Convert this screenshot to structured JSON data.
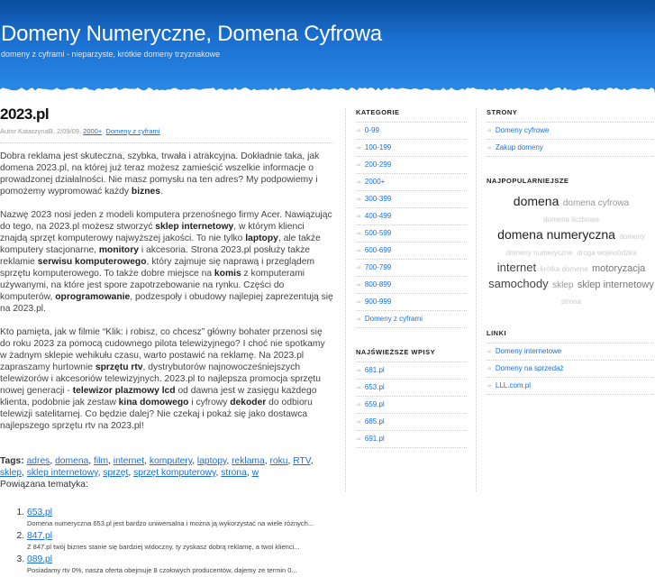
{
  "header": {
    "title": "Domeny Numeryczne, Domena Cyfrowa",
    "description": "domeny z cyframi - nieparzyste, krótkie domeny trzyznakowe"
  },
  "post": {
    "title": "2023.pl",
    "meta_prefix": "Autor KatarzynaB. 2/09/09.",
    "categories": [
      "2000+",
      "Domeny z cyframi"
    ],
    "p1": [
      "Dobra reklama jest skuteczna, szybka, trwała i atrakcyjna. Dokładnie taka, jak domena 2023.pl, na której już teraz możesz zamieścić wszelkie informacje o prowadzonej działalności. Nie masz pomysłu na ten adres? My podpowiemy i pomożemy wypromować każdy ",
      "biznes",
      "."
    ],
    "p2": [
      "Nazwę 2023 nosi jeden z modeli komputera przenośnego firmy Acer. Nawiązując do tego, na 2023.pl możesz stworzyć ",
      "sklep internetowy",
      ", w którym klienci znajdą sprzęt komputerowy najwyższej jakości. To nie tylko ",
      "laptopy",
      ", ale także komputery stacjonarne, ",
      "monitory",
      " i akcesoria. Strona 2023.pl posłuży także reklamie ",
      "serwisu komputerowego",
      ", który zajmuje się naprawą i przeglądem sprzętu komputerowego. To także dobre miejsce na ",
      "komis",
      " z komputerami używanymi, na które jest spore zapotrzebowanie na rynku. Części do komputerów, ",
      "oprogramowanie",
      ", podzespoły i obudowy najlepiej zaprezentują się na 2023.pl."
    ],
    "p3": [
      "Kto pamięta, jak w filmie “Klik: i robisz, co chcesz” główny bohater przenosi się do roku 2023 za pomocą cudownego pilota telewizyjnego? I choć nie spotkamy w żadnym sklepie wehikułu czasu, warto postawić na reklamę. Na 2023.pl zapraszamy hurtownie ",
      "sprzętu rtv",
      ", dystrybutorów najnowocześniejszych telewizorów i akcesoriów telewizyjnych. 2023.pl to najlepsza promocja sprzętu nowej generacji - ",
      "telewizor plazmowy lcd",
      " od dawna jest w zasięgu każdego klienta, podobnie jak zestaw ",
      "kina domowego",
      " i cyfrowy ",
      "dekoder",
      " do odbioru telewizji satelitarnej. Co będzie dalej? Nie czekaj i pokaż się jako dostawca najlepszego sprzętu rtv na 2023.pl!"
    ],
    "tags_label": "Tags:",
    "tags": [
      "adres",
      "domena",
      "film",
      "internet",
      "komputery",
      "laptopy",
      "reklama",
      "roku",
      "RTV",
      "sklep",
      "sklep internetowy",
      "sprzęt",
      "sprzęt komputerowy",
      "strona",
      "w"
    ],
    "related_label": "Powiązana tematyka:",
    "related": [
      {
        "title": "653.pl",
        "excerpt": "Domena numeryczna 653.pl jest bardzo uniwersalna i można ją wykorzystać na wiele różnych..."
      },
      {
        "title": "847.pl",
        "excerpt": "Z 847.pl twój biznes stanie się bardziej widoczny, ty zyskasz dobrą reklamę, a twoi klienci..."
      },
      {
        "title": "089.pl",
        "excerpt": "Posiadamy rtv 0%, nasza oferta obejmuje 8 czołowych producentów, dajemy ze termin 0..."
      }
    ]
  },
  "sidebar": {
    "categories_title": "KATEGORIE",
    "categories": [
      "0-99",
      "100-199",
      "200-299",
      "2000+",
      "300-399",
      "400-499",
      "500-599",
      "600-699",
      "700-799",
      "800-899",
      "900-999",
      "Domeny z cyframi"
    ],
    "recent_title": "NAJŚWIEŻSZE WPISY",
    "recent": [
      "681.pl",
      "653.pl",
      "659.pl",
      "685.pl",
      "691.pl"
    ],
    "pages_title": "STRONY",
    "pages": [
      "Domeny cyfrowe",
      "Zakup domeny"
    ],
    "popular_title": "NAJPOPULARNIEJSZE",
    "cloud": [
      {
        "label": "domena",
        "weight": 5
      },
      {
        "label": "domena cyfrowa",
        "weight": 2
      },
      {
        "label": "domena liczbowa",
        "weight": 1
      },
      {
        "label": "domena numeryczna",
        "weight": 5
      },
      {
        "label": "domeny",
        "weight": 1
      },
      {
        "label": "domeny numeryczne",
        "weight": 1
      },
      {
        "label": "droga wojewódzka",
        "weight": 1
      },
      {
        "label": "internet",
        "weight": 4
      },
      {
        "label": "krótka domena",
        "weight": 1
      },
      {
        "label": "motoryzacja",
        "weight": 3
      },
      {
        "label": "samochody",
        "weight": 4
      },
      {
        "label": "sklep",
        "weight": 2
      },
      {
        "label": "sklep internetowy",
        "weight": 3
      },
      {
        "label": "strona",
        "weight": 1
      }
    ],
    "links_title": "LINKI",
    "links": [
      "Domeny internetowe",
      "Domeny na sprzedaż",
      "LLL.com.pl"
    ]
  }
}
